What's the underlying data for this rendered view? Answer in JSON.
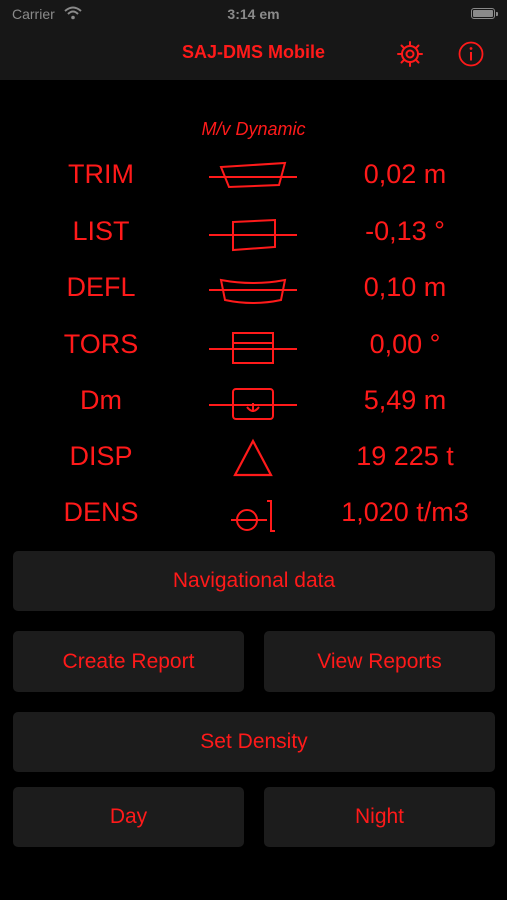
{
  "status_bar": {
    "carrier": "Carrier",
    "time": "3:14 em"
  },
  "nav": {
    "title": "SAJ-DMS Mobile"
  },
  "subtitle": "M/v Dynamic",
  "rows": [
    {
      "label": "TRIM",
      "value": "0,02 m"
    },
    {
      "label": "LIST",
      "value": "-0,13 °"
    },
    {
      "label": "DEFL",
      "value": "0,10 m"
    },
    {
      "label": "TORS",
      "value": "0,00 °"
    },
    {
      "label": "Dm",
      "value": "5,49 m"
    },
    {
      "label": "DISP",
      "value": "19 225 t"
    },
    {
      "label": "DENS",
      "value": "1,020 t/m3"
    }
  ],
  "buttons": {
    "navigational": "Navigational data",
    "create_report": "Create Report",
    "view_reports": "View Reports",
    "set_density": "Set Density",
    "day": "Day",
    "night": "Night"
  },
  "colors": {
    "accent": "#ff1a1a",
    "background": "#000000",
    "bar": "#171717",
    "button": "#1c1c1c"
  }
}
